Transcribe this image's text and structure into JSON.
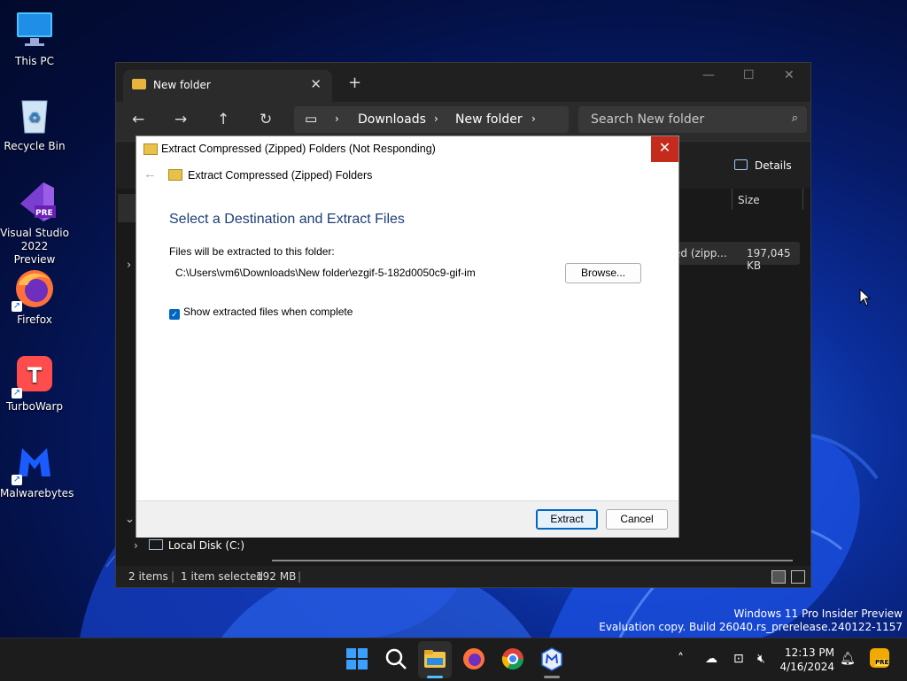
{
  "desktop": {
    "icons": [
      {
        "label": "This PC",
        "icon": "monitor-icon"
      },
      {
        "label": "Recycle Bin",
        "icon": "recycle-bin-icon"
      },
      {
        "label": "Visual Studio 2022 Preview",
        "icon": "visual-studio-icon",
        "badge": "PRE"
      },
      {
        "label": "Firefox",
        "icon": "firefox-icon"
      },
      {
        "label": "TurboWarp",
        "icon": "turbowarp-icon"
      },
      {
        "label": "Malwarebytes",
        "icon": "malwarebytes-icon"
      }
    ]
  },
  "explorer": {
    "tab_title": "New folder",
    "breadcrumb": [
      "Downloads",
      "New folder"
    ],
    "search_placeholder": "Search New folder",
    "details_label": "Details",
    "column_size": "Size",
    "file_row": {
      "type": "ed (zipp...",
      "size": "197,045 KB"
    },
    "nav_local_disk": "Local Disk (C:)",
    "status": {
      "items": "2 items",
      "selected": "1 item selected",
      "size": "192 MB"
    }
  },
  "dialog": {
    "title": "Extract Compressed (Zipped) Folders (Not Responding)",
    "subtitle": "Extract Compressed (Zipped) Folders",
    "heading": "Select a Destination and Extract Files",
    "dest_label": "Files will be extracted to this folder:",
    "dest_path": "C:\\Users\\vm6\\Downloads\\New folder\\ezgif-5-182d0050c9-gif-im",
    "browse_label": "Browse...",
    "checkbox_label": "Show extracted files when complete",
    "checkbox_checked": true,
    "extract_label": "Extract",
    "cancel_label": "Cancel"
  },
  "watermark": {
    "line1": "Windows 11 Pro Insider Preview",
    "line2": "Evaluation copy. Build 26040.rs_prerelease.240122-1157"
  },
  "taskbar": {
    "apps": [
      "start-icon",
      "search-icon",
      "file-explorer-icon",
      "firefox-icon",
      "chrome-icon",
      "malwarebytes-icon"
    ],
    "clock_time": "12:13 PM",
    "clock_date": "4/16/2024",
    "tray_badge": "PRE"
  },
  "colors": {
    "accent": "#0067c0",
    "close_red": "#c42b1c",
    "heading_blue": "#1e3e78"
  }
}
